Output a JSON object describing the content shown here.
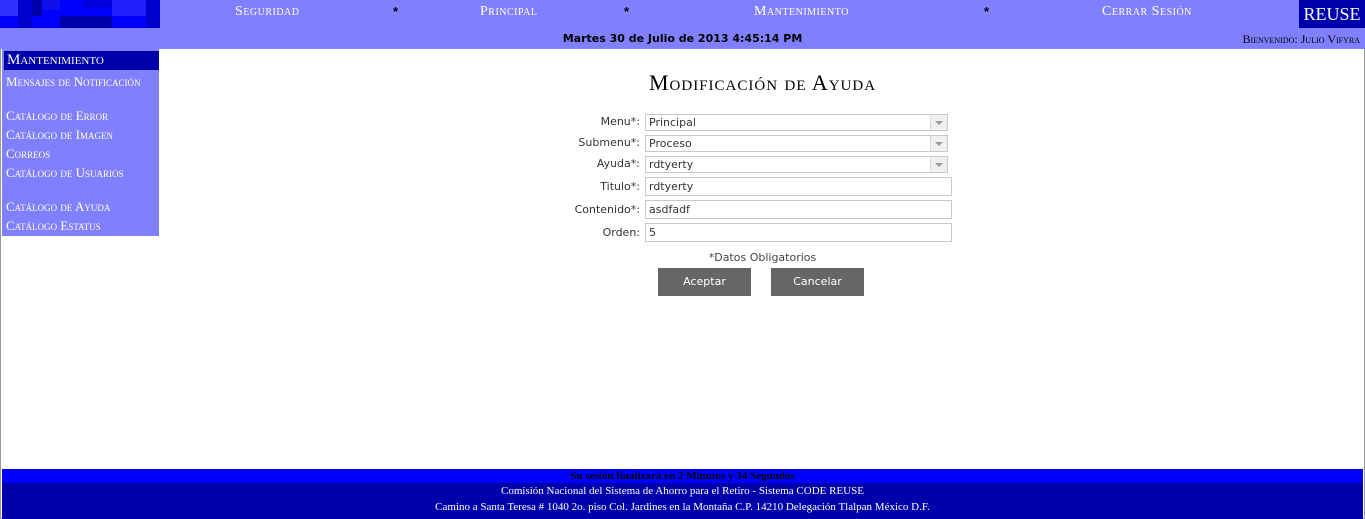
{
  "header": {
    "nav": [
      "Seguridad",
      "Principal",
      "Mantenimiento",
      "Cerrar Sesión"
    ],
    "separator": "*",
    "brand": "REUSE",
    "date": "Martes 30 de Julio de 2013 4:45:14 PM",
    "welcome": "Bienvenido: Julio Vifyra",
    "colors": {
      "bar": "#8080ff",
      "dark": "#0000aa",
      "bright": "#0000ff"
    }
  },
  "sidebar": {
    "title": "Mantenimiento",
    "items": [
      "Mensajes de Notificación",
      "Catálogo de Error",
      "Catálogo de Imagen",
      "Correos",
      "Catálogo de Usuarios",
      "Catálogo de Ayuda",
      "Catálogo Estatus"
    ]
  },
  "form": {
    "title": "Modificación de Ayuda",
    "fields": {
      "menu": {
        "label": "Menu*:",
        "value": "Principal"
      },
      "submenu": {
        "label": "Submenu*:",
        "value": "Proceso"
      },
      "ayuda": {
        "label": "Ayuda*:",
        "value": "rdtyerty"
      },
      "titulo": {
        "label": "Titulo*:",
        "value": "rdtyerty"
      },
      "contenido": {
        "label": "Contenido*:",
        "value": "asdfadf"
      },
      "orden": {
        "label": "Orden:",
        "value": "5"
      }
    },
    "required_note": "*Datos Obligatorios",
    "accept_label": "Aceptar",
    "cancel_label": "Cancelar"
  },
  "footer": {
    "session": "Su sesión finalizará en 2 Minutos y 34 Segundos",
    "line1": "Comisión Nacional del Sistema de Ahorro para el Retiro - Sistema CODE REUSE",
    "line2": "Camino a Santa Teresa # 1040 2o. piso Col. Jardines en la Montaña C.P. 14210 Delegación Tlalpan México D.F."
  }
}
